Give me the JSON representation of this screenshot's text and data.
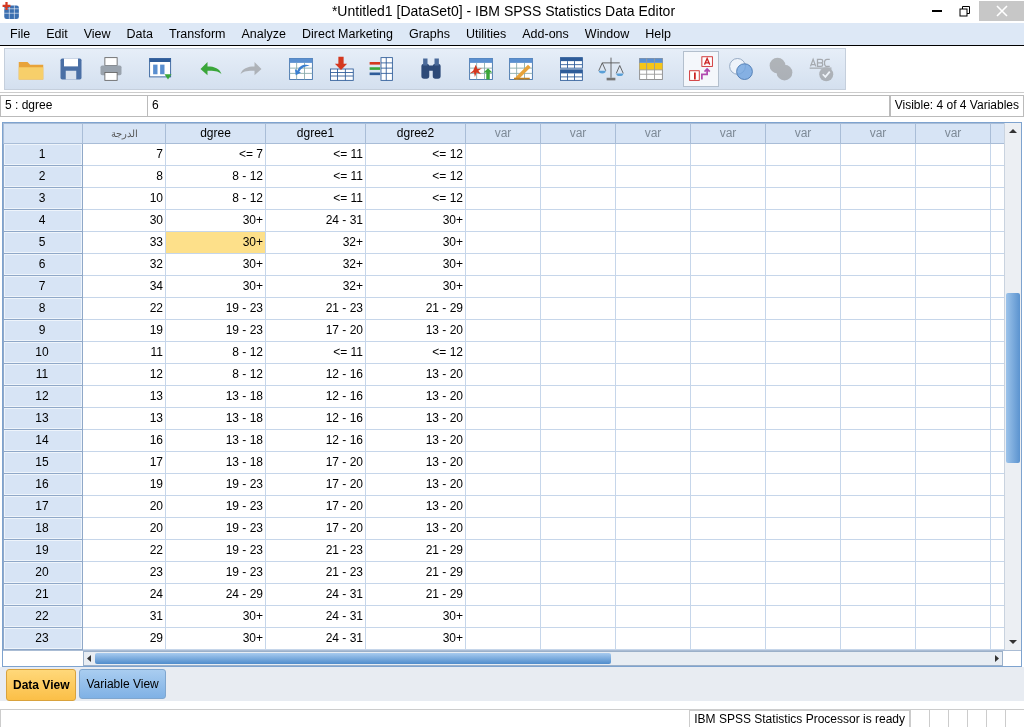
{
  "window": {
    "title": "*Untitled1 [DataSet0] - IBM SPSS Statistics Data Editor"
  },
  "menu": [
    "File",
    "Edit",
    "View",
    "Data",
    "Transform",
    "Analyze",
    "Direct Marketing",
    "Graphs",
    "Utilities",
    "Add-ons",
    "Window",
    "Help"
  ],
  "toolbar": [
    [
      {
        "kind": "folder",
        "disabled": false,
        "on": false
      },
      {
        "kind": "floppy-disk",
        "disabled": false,
        "on": false
      },
      {
        "kind": "printer",
        "disabled": false,
        "on": false
      }
    ],
    [
      {
        "kind": "window",
        "disabled": false,
        "on": false
      }
    ],
    [
      {
        "kind": "undo",
        "disabled": false,
        "on": false
      },
      {
        "kind": "redo",
        "disabled": true,
        "on": false
      }
    ],
    [
      {
        "kind": "grid-arrow",
        "disabled": false,
        "on": false
      },
      {
        "kind": "grid-down-arrow",
        "disabled": false,
        "on": false
      },
      {
        "kind": "list-grid",
        "disabled": false,
        "on": false
      }
    ],
    [
      {
        "kind": "binoculars",
        "disabled": false,
        "on": false
      }
    ],
    [
      {
        "kind": "grid-star",
        "disabled": false,
        "on": false
      },
      {
        "kind": "grid-pencil",
        "disabled": false,
        "on": false
      }
    ],
    [
      {
        "kind": "split-grid",
        "disabled": false,
        "on": false
      },
      {
        "kind": "scale",
        "disabled": false,
        "on": false
      },
      {
        "kind": "highlighted-grid",
        "disabled": false,
        "on": false
      }
    ],
    [
      {
        "kind": "value-labels",
        "disabled": false,
        "on": true
      },
      {
        "kind": "circles",
        "disabled": false,
        "on": false
      },
      {
        "kind": "filled-circles",
        "disabled": true,
        "on": false
      },
      {
        "kind": "spell-check",
        "disabled": true,
        "on": false
      }
    ]
  ],
  "cell_editor": {
    "cell": "5 : dgree",
    "value": "6",
    "visible": "Visible: 4 of 4 Variables"
  },
  "table": {
    "columns": [
      {
        "label": "الدرجة",
        "kind": "defined"
      },
      {
        "label": "dgree",
        "kind": "defined"
      },
      {
        "label": "dgree1",
        "kind": "defined"
      },
      {
        "label": "dgree2",
        "kind": "defined"
      },
      {
        "label": "var",
        "kind": "empty"
      },
      {
        "label": "var",
        "kind": "empty"
      },
      {
        "label": "var",
        "kind": "empty"
      },
      {
        "label": "var",
        "kind": "empty"
      },
      {
        "label": "var",
        "kind": "empty"
      },
      {
        "label": "var",
        "kind": "empty"
      },
      {
        "label": "var",
        "kind": "empty"
      }
    ],
    "rows": [
      {
        "number": "1",
        "cells": [
          {
            "value": "7",
            "selected": false
          },
          {
            "value": "<= 7",
            "selected": false
          },
          {
            "value": "<= 11",
            "selected": false
          },
          {
            "value": "<= 12",
            "selected": false
          }
        ]
      },
      {
        "number": "2",
        "cells": [
          {
            "value": "8",
            "selected": false
          },
          {
            "value": "8 - 12",
            "selected": false
          },
          {
            "value": "<= 11",
            "selected": false
          },
          {
            "value": "<= 12",
            "selected": false
          }
        ]
      },
      {
        "number": "3",
        "cells": [
          {
            "value": "10",
            "selected": false
          },
          {
            "value": "8 - 12",
            "selected": false
          },
          {
            "value": "<= 11",
            "selected": false
          },
          {
            "value": "<= 12",
            "selected": false
          }
        ]
      },
      {
        "number": "4",
        "cells": [
          {
            "value": "30",
            "selected": false
          },
          {
            "value": "30+",
            "selected": false
          },
          {
            "value": "24 - 31",
            "selected": false
          },
          {
            "value": "30+",
            "selected": false
          }
        ]
      },
      {
        "number": "5",
        "cells": [
          {
            "value": "33",
            "selected": false
          },
          {
            "value": "30+",
            "selected": true
          },
          {
            "value": "32+",
            "selected": false
          },
          {
            "value": "30+",
            "selected": false
          }
        ]
      },
      {
        "number": "6",
        "cells": [
          {
            "value": "32",
            "selected": false
          },
          {
            "value": "30+",
            "selected": false
          },
          {
            "value": "32+",
            "selected": false
          },
          {
            "value": "30+",
            "selected": false
          }
        ]
      },
      {
        "number": "7",
        "cells": [
          {
            "value": "34",
            "selected": false
          },
          {
            "value": "30+",
            "selected": false
          },
          {
            "value": "32+",
            "selected": false
          },
          {
            "value": "30+",
            "selected": false
          }
        ]
      },
      {
        "number": "8",
        "cells": [
          {
            "value": "22",
            "selected": false
          },
          {
            "value": "19 - 23",
            "selected": false
          },
          {
            "value": "21 - 23",
            "selected": false
          },
          {
            "value": "21 - 29",
            "selected": false
          }
        ]
      },
      {
        "number": "9",
        "cells": [
          {
            "value": "19",
            "selected": false
          },
          {
            "value": "19 - 23",
            "selected": false
          },
          {
            "value": "17 - 20",
            "selected": false
          },
          {
            "value": "13 - 20",
            "selected": false
          }
        ]
      },
      {
        "number": "10",
        "cells": [
          {
            "value": "11",
            "selected": false
          },
          {
            "value": "8 - 12",
            "selected": false
          },
          {
            "value": "<= 11",
            "selected": false
          },
          {
            "value": "<= 12",
            "selected": false
          }
        ]
      },
      {
        "number": "11",
        "cells": [
          {
            "value": "12",
            "selected": false
          },
          {
            "value": "8 - 12",
            "selected": false
          },
          {
            "value": "12 - 16",
            "selected": false
          },
          {
            "value": "13 - 20",
            "selected": false
          }
        ]
      },
      {
        "number": "12",
        "cells": [
          {
            "value": "13",
            "selected": false
          },
          {
            "value": "13 - 18",
            "selected": false
          },
          {
            "value": "12 - 16",
            "selected": false
          },
          {
            "value": "13 - 20",
            "selected": false
          }
        ]
      },
      {
        "number": "13",
        "cells": [
          {
            "value": "13",
            "selected": false
          },
          {
            "value": "13 - 18",
            "selected": false
          },
          {
            "value": "12 - 16",
            "selected": false
          },
          {
            "value": "13 - 20",
            "selected": false
          }
        ]
      },
      {
        "number": "14",
        "cells": [
          {
            "value": "16",
            "selected": false
          },
          {
            "value": "13 - 18",
            "selected": false
          },
          {
            "value": "12 - 16",
            "selected": false
          },
          {
            "value": "13 - 20",
            "selected": false
          }
        ]
      },
      {
        "number": "15",
        "cells": [
          {
            "value": "17",
            "selected": false
          },
          {
            "value": "13 - 18",
            "selected": false
          },
          {
            "value": "17 - 20",
            "selected": false
          },
          {
            "value": "13 - 20",
            "selected": false
          }
        ]
      },
      {
        "number": "16",
        "cells": [
          {
            "value": "19",
            "selected": false
          },
          {
            "value": "19 - 23",
            "selected": false
          },
          {
            "value": "17 - 20",
            "selected": false
          },
          {
            "value": "13 - 20",
            "selected": false
          }
        ]
      },
      {
        "number": "17",
        "cells": [
          {
            "value": "20",
            "selected": false
          },
          {
            "value": "19 - 23",
            "selected": false
          },
          {
            "value": "17 - 20",
            "selected": false
          },
          {
            "value": "13 - 20",
            "selected": false
          }
        ]
      },
      {
        "number": "18",
        "cells": [
          {
            "value": "20",
            "selected": false
          },
          {
            "value": "19 - 23",
            "selected": false
          },
          {
            "value": "17 - 20",
            "selected": false
          },
          {
            "value": "13 - 20",
            "selected": false
          }
        ]
      },
      {
        "number": "19",
        "cells": [
          {
            "value": "22",
            "selected": false
          },
          {
            "value": "19 - 23",
            "selected": false
          },
          {
            "value": "21 - 23",
            "selected": false
          },
          {
            "value": "21 - 29",
            "selected": false
          }
        ]
      },
      {
        "number": "20",
        "cells": [
          {
            "value": "23",
            "selected": false
          },
          {
            "value": "19 - 23",
            "selected": false
          },
          {
            "value": "21 - 23",
            "selected": false
          },
          {
            "value": "21 - 29",
            "selected": false
          }
        ]
      },
      {
        "number": "21",
        "cells": [
          {
            "value": "24",
            "selected": false
          },
          {
            "value": "24 - 29",
            "selected": false
          },
          {
            "value": "24 - 31",
            "selected": false
          },
          {
            "value": "21 - 29",
            "selected": false
          }
        ]
      },
      {
        "number": "22",
        "cells": [
          {
            "value": "31",
            "selected": false
          },
          {
            "value": "30+",
            "selected": false
          },
          {
            "value": "24 - 31",
            "selected": false
          },
          {
            "value": "30+",
            "selected": false
          }
        ]
      },
      {
        "number": "23",
        "cells": [
          {
            "value": "29",
            "selected": false
          },
          {
            "value": "30+",
            "selected": false
          },
          {
            "value": "24 - 31",
            "selected": false
          },
          {
            "value": "30+",
            "selected": false
          }
        ]
      }
    ]
  },
  "view_tabs": [
    {
      "label": "Data View",
      "selected": true
    },
    {
      "label": "Variable View",
      "selected": false
    }
  ],
  "status_bar": {
    "text": "IBM SPSS Statistics Processor is ready"
  }
}
